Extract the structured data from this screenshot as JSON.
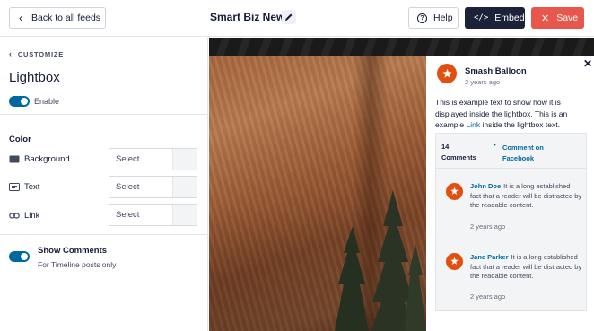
{
  "header": {
    "back_label": "Back to all feeds",
    "feed_title": "Smart Biz News",
    "help_label": "Help",
    "embed_label": "Embed",
    "save_label": "Save"
  },
  "sidebar": {
    "breadcrumb": "CUSTOMIZE",
    "title": "Lightbox",
    "enable_label": "Enable",
    "enable_on": true,
    "color_heading": "Color",
    "color_rows": [
      {
        "label": "Background",
        "value": "Select",
        "icon": "background-icon"
      },
      {
        "label": "Text",
        "value": "Select",
        "icon": "text-icon"
      },
      {
        "label": "Link",
        "value": "Select",
        "icon": "link-icon"
      }
    ],
    "show_comments_label": "Show Comments",
    "show_comments_sub": "For Timeline posts only",
    "show_comments_on": true
  },
  "lightbox": {
    "account_name": "Smash Balloon",
    "time": "2 years ago",
    "caption_pre": "This is example text to show how it is displayed inside the lightbox. This is an example ",
    "caption_link": "Link",
    "caption_post": " inside the lightbox text.",
    "comments_count": "14",
    "comments_label": "Comments",
    "comment_on_facebook": "Comment on Facebook",
    "comments": [
      {
        "author": "John Doe",
        "text": "It is a long established fact that a reader will be distracted by the readable content.",
        "time": "2 years ago"
      },
      {
        "author": "Jane Parker",
        "text": "It is a long established fact that a reader will be distracted by the readable content.",
        "time": "2 years ago"
      }
    ]
  },
  "colors": {
    "accent": "#0068a0",
    "save": "#e8574c",
    "embed": "#1c2239",
    "avatar": "#e34f0e"
  }
}
